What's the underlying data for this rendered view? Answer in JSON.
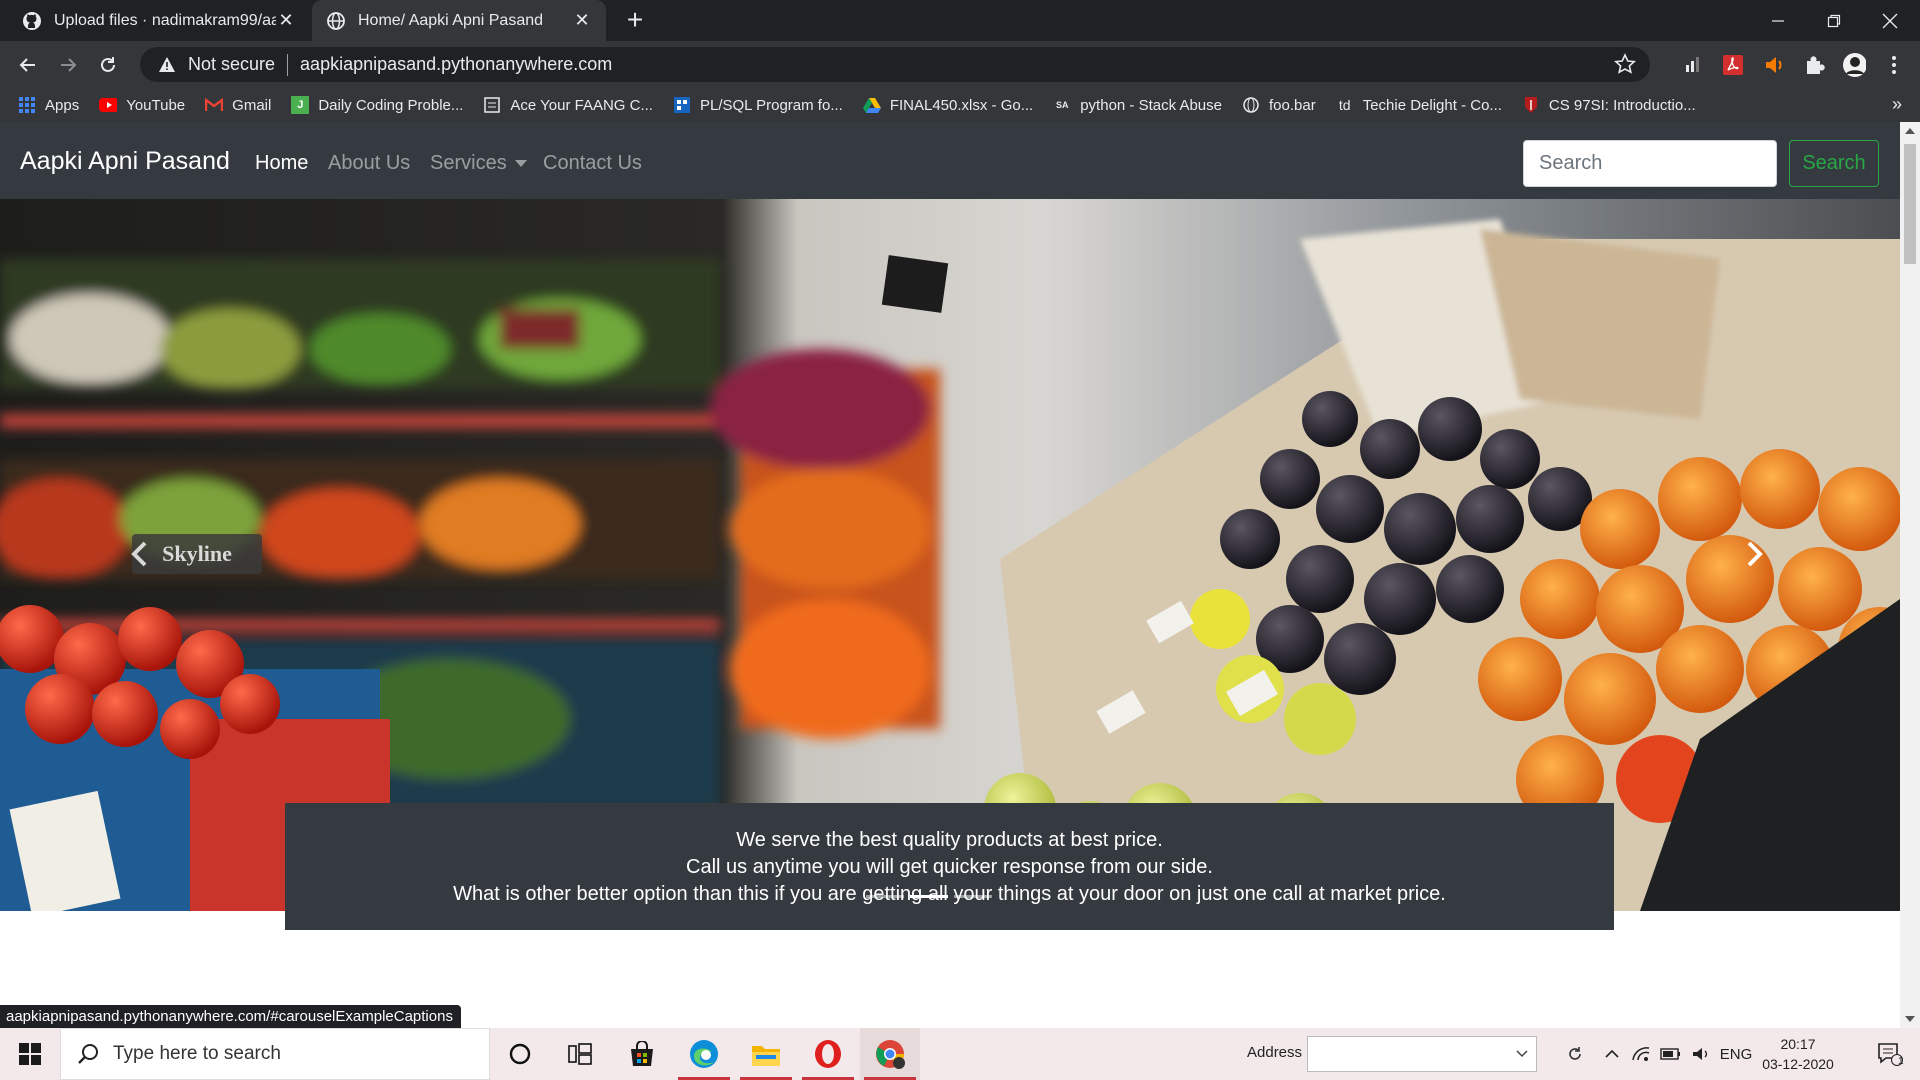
{
  "browser": {
    "tabs": [
      {
        "title": "Upload files · nadimakram99/aapkiapnipasand",
        "icon": "github-icon"
      },
      {
        "title": "Home/ Aapki Apni Pasand",
        "icon": "globe-icon"
      }
    ],
    "omnibox": {
      "security_label": "Not secure",
      "url": "aapkiapnipasand.pythonanywhere.com"
    },
    "bookmarks": [
      {
        "label": "Apps",
        "icon": "apps-grid-icon"
      },
      {
        "label": "YouTube",
        "icon": "youtube-icon"
      },
      {
        "label": "Gmail",
        "icon": "gmail-icon"
      },
      {
        "label": "Daily Coding Proble...",
        "icon": "bookmark-icon"
      },
      {
        "label": "Ace Your FAANG C...",
        "icon": "bookmark-icon"
      },
      {
        "label": "PL/SQL Program fo...",
        "icon": "bookmark-icon"
      },
      {
        "label": "FINAL450.xlsx - Go...",
        "icon": "drive-icon"
      },
      {
        "label": "python - Stack Abuse",
        "icon": "stackabuse-icon"
      },
      {
        "label": "foo.bar",
        "icon": "globe-icon"
      },
      {
        "label": "Techie Delight - Co...",
        "icon": "td-icon"
      },
      {
        "label": "CS 97SI: Introductio...",
        "icon": "stanford-icon"
      }
    ],
    "status_url": "aapkiapnipasand.pythonanywhere.com/#carouselExampleCaptions"
  },
  "site": {
    "brand": "Aapki Apni Pasand",
    "nav": {
      "home": "Home",
      "about": "About Us",
      "services": "Services",
      "contact": "Contact Us"
    },
    "search": {
      "placeholder": "Search",
      "button": "Search"
    },
    "carousel": {
      "caption_lines": [
        "We serve the best quality products at best price.",
        "Call us anytime you will get quicker response from our side.",
        "What is other better option than this if you are getting all your things at your door on just one call at market price."
      ],
      "slides": 3,
      "active_slide": 2,
      "sign_text": "Skyline"
    }
  },
  "taskbar": {
    "search_placeholder": "Type here to search",
    "address_label": "Address",
    "language": "ENG",
    "time": "20:17",
    "date": "03-12-2020",
    "notification_count": "1"
  },
  "colors": {
    "navbar": "#343a40",
    "search_button": "#28a745",
    "tab_strip": "#202124",
    "toolbar": "#35363a"
  }
}
